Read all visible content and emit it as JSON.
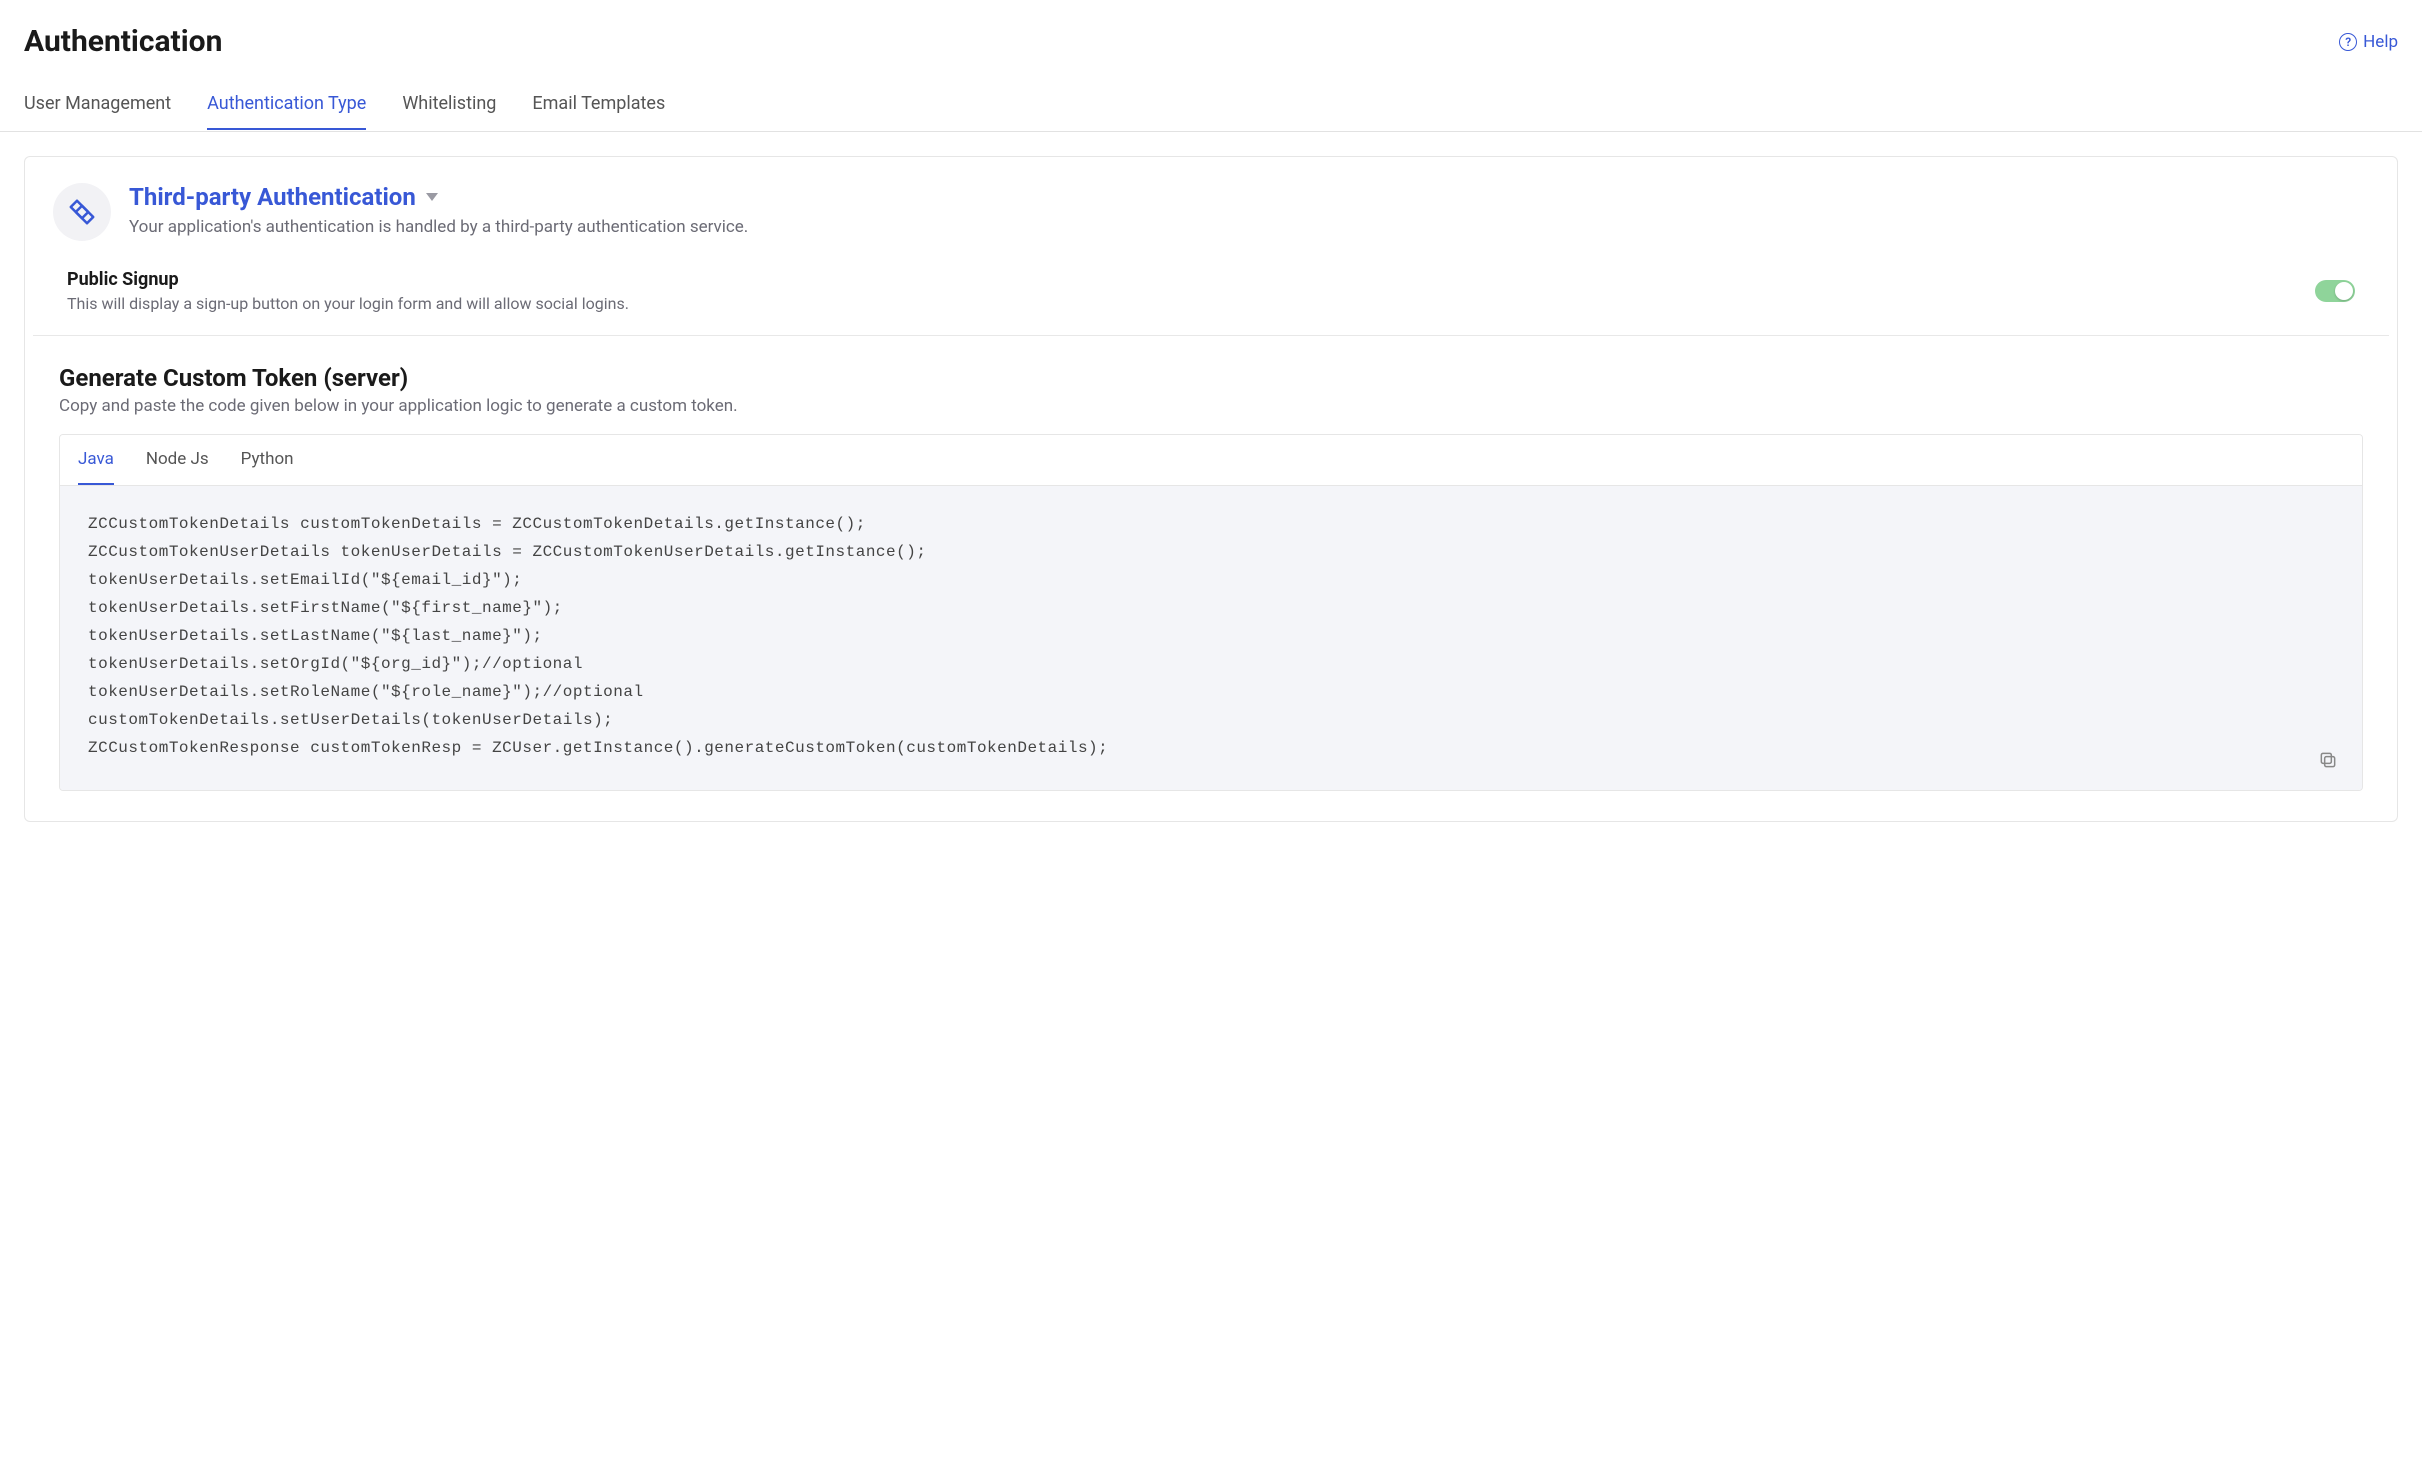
{
  "header": {
    "title": "Authentication",
    "help_label": "Help"
  },
  "tabs": [
    {
      "label": "User Management",
      "active": false
    },
    {
      "label": "Authentication Type",
      "active": true
    },
    {
      "label": "Whitelisting",
      "active": false
    },
    {
      "label": "Email Templates",
      "active": false
    }
  ],
  "auth_type": {
    "title": "Third-party Authentication",
    "description": "Your application's authentication is handled by a third-party authentication service."
  },
  "public_signup": {
    "title": "Public Signup",
    "description": "This will display a sign-up button on your login form and will allow social logins.",
    "enabled": true
  },
  "generate_token": {
    "title": "Generate Custom Token (server)",
    "description": "Copy and paste the code given below in your application logic to generate a custom token.",
    "code_tabs": [
      {
        "label": "Java",
        "active": true
      },
      {
        "label": "Node Js",
        "active": false
      },
      {
        "label": "Python",
        "active": false
      }
    ],
    "code": "ZCCustomTokenDetails customTokenDetails = ZCCustomTokenDetails.getInstance();\nZCCustomTokenUserDetails tokenUserDetails = ZCCustomTokenUserDetails.getInstance();\ntokenUserDetails.setEmailId(\"${email_id}\");\ntokenUserDetails.setFirstName(\"${first_name}\");\ntokenUserDetails.setLastName(\"${last_name}\");\ntokenUserDetails.setOrgId(\"${org_id}\");//optional\ntokenUserDetails.setRoleName(\"${role_name}\");//optional\ncustomTokenDetails.setUserDetails(tokenUserDetails);\nZCCustomTokenResponse customTokenResp = ZCUser.getInstance().generateCustomToken(customTokenDetails);"
  }
}
